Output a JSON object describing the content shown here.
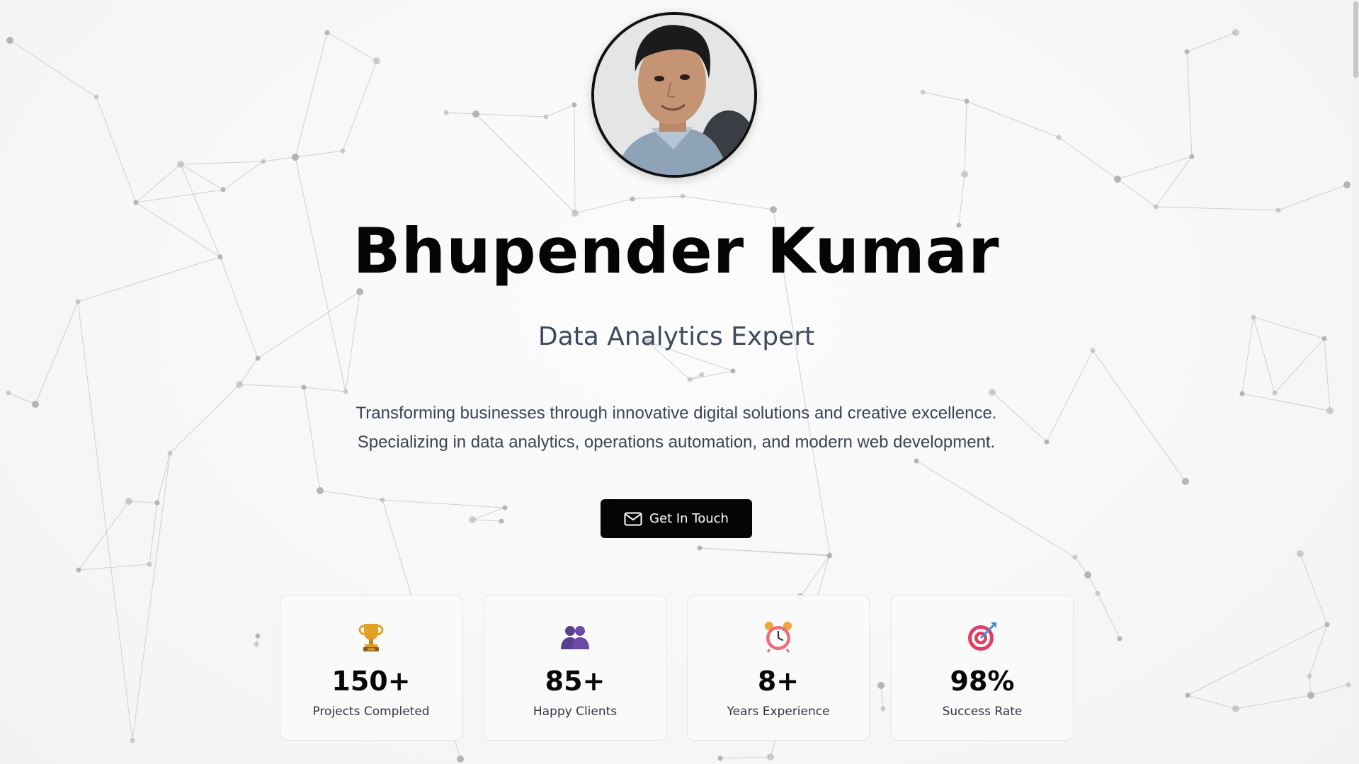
{
  "hero": {
    "name": "Bhupender Kumar",
    "role": "Data Analytics Expert",
    "description_lines": [
      "Transforming businesses through innovative digital solutions and creative excellence.",
      "Specializing in data analytics, operations automation, and modern web development."
    ],
    "cta_label": "Get In Touch",
    "cta_icon": "mail-icon",
    "avatar_icon": "profile-photo"
  },
  "stats": [
    {
      "icon": "trophy-icon",
      "value": "150+",
      "label": "Projects Completed"
    },
    {
      "icon": "people-icon",
      "value": "85+",
      "label": "Happy Clients"
    },
    {
      "icon": "alarm-clock-icon",
      "value": "8+",
      "label": "Years Experience"
    },
    {
      "icon": "target-icon",
      "value": "98%",
      "label": "Success Rate"
    }
  ],
  "colors": {
    "background": "#f7f7f8",
    "text_primary": "#050505",
    "text_secondary": "#3f4a5a",
    "button_bg": "#050505",
    "button_text": "#ffffff",
    "card_border": "#e4e4e7"
  }
}
